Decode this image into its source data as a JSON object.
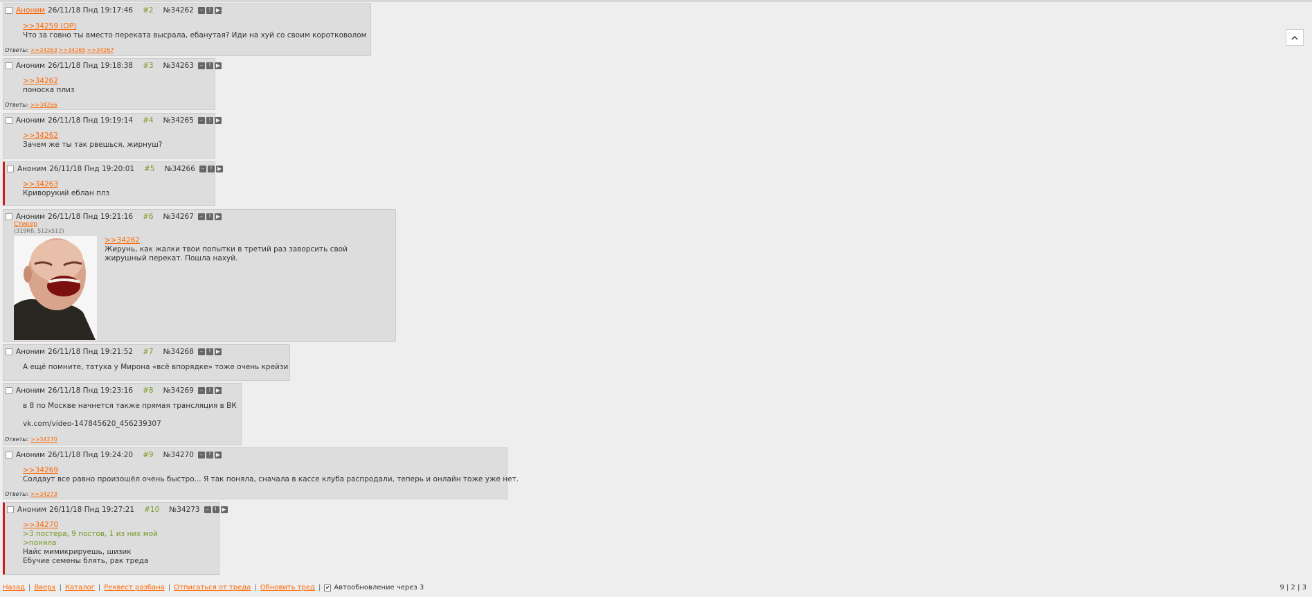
{
  "posts": [
    {
      "author": "Аноним",
      "date": "26/11/18 Пнд 19:17:46",
      "num": "#2",
      "id": "№34262",
      "reply": ">>34259 (OP)",
      "lines": [
        "Что за говно ты вместо переката высрала, ебанутая? Иди на хуй со своим коротковолом"
      ],
      "answers_label": "Ответы:",
      "answers": [
        ">>34263",
        ">>34265",
        ">>34267"
      ]
    },
    {
      "author": "Аноним",
      "date": "26/11/18 Пнд 19:18:38",
      "num": "#3",
      "id": "№34263",
      "reply": ">>34262",
      "lines": [
        "поноска плиз"
      ],
      "answers_label": "Ответы:",
      "answers": [
        ">>34266"
      ]
    },
    {
      "author": "Аноним",
      "date": "26/11/18 Пнд 19:19:14",
      "num": "#4",
      "id": "№34265",
      "reply": ">>34262",
      "lines": [
        "Зачем же ты так рвешься, жирнуш?"
      ]
    },
    {
      "author": "Аноним",
      "date": "26/11/18 Пнд 19:20:01",
      "num": "#5",
      "id": "№34266",
      "reply": ">>34263",
      "lines": [
        "Криворукий еблан плз"
      ]
    },
    {
      "author": "Аноним",
      "date": "26/11/18 Пнд 19:21:16",
      "num": "#6",
      "id": "№34267",
      "file_name": "Стикер",
      "file_meta": "(319Кб, 512x512)",
      "reply": ">>34262",
      "lines": [
        "Жирунь, как жалки твои попытки в третий раз заворсить свой",
        "жирушный перекат. Пошла нахуй."
      ]
    },
    {
      "author": "Аноним",
      "date": "26/11/18 Пнд 19:21:52",
      "num": "#7",
      "id": "№34268",
      "lines": [
        "А ещё помните, татуха у Мирона «всё впорядке» тоже очень крейзи"
      ]
    },
    {
      "author": "Аноним",
      "date": "26/11/18 Пнд 19:23:16",
      "num": "#8",
      "id": "№34269",
      "lines": [
        "в 8 по Москве начнется также прямая трансляция в ВК",
        "",
        "vk.com/video-147845620_456239307"
      ],
      "answers_label": "Ответы:",
      "answers": [
        ">>34270"
      ]
    },
    {
      "author": "Аноним",
      "date": "26/11/18 Пнд 19:24:20",
      "num": "#9",
      "id": "№34270",
      "reply": ">>34269",
      "lines": [
        "Солдаут все равно произошёл очень быстро... Я так поняла, сначала в кассе клуба распродали, теперь и онлайн тоже уже нет."
      ],
      "answers_label": "Ответы:",
      "answers": [
        ">>34273"
      ]
    },
    {
      "author": "Аноним",
      "date": "26/11/18 Пнд 19:27:21",
      "num": "#10",
      "id": "№34273",
      "reply": ">>34270",
      "quotes": [
        ">3 постера, 9 постов, 1 из них мой",
        ">поняла"
      ],
      "lines": [
        "Найс мимикрируешь, шизик",
        "Ебучие семены блять, рак треда"
      ]
    }
  ],
  "footer": {
    "links": [
      "Назад",
      "Вверх",
      "Каталог",
      "Реквест разбана",
      "Отписаться от треда",
      "Обновить тред"
    ],
    "autoupdate_label": "Автообновление через 3",
    "autoupdate_checked": "✔"
  },
  "pagination": "9 | 2 | 3",
  "icons": {
    "up": "chevron-up-icon",
    "hide": "minus-icon",
    "report": "exclamation-icon",
    "menu": "play-icon"
  },
  "colors": {
    "link": "#ff6600",
    "quote": "#789922",
    "accent": "#cc1b1b",
    "post_bg": "#dddddd",
    "page_bg": "#eeeeee"
  }
}
